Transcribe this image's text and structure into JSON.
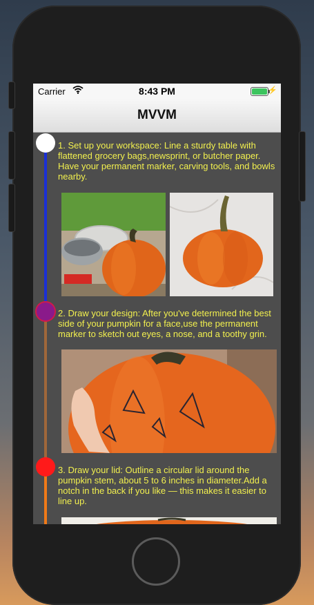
{
  "status_bar": {
    "carrier": "Carrier",
    "time": "8:43 PM",
    "battery_level": 1.0,
    "icons": [
      "wifi-icon",
      "battery-icon",
      "charging-bolt-icon"
    ]
  },
  "nav": {
    "title": "MVVM"
  },
  "colors": {
    "step_text": "#f2f04e",
    "background": "#4d4d4d",
    "line_step1": "#1a2fd6",
    "line_step2": "#a0673a",
    "line_step3": "#f07a18",
    "node_step1": "#ffffff",
    "node_step2": "#8a1a8a",
    "node_step3": "#ff1a1a"
  },
  "steps": [
    {
      "text": "1. Set up your workspace: Line a sturdy table with flattened grocery bags,newsprint, or butcher paper. Have your permanent marker, carving tools, and bowls nearby."
    },
    {
      "text": "2. Draw your design: After you've determined the best side of your pumpkin for a face,use the permanent marker to sketch out eyes, a nose, and a toothy grin."
    },
    {
      "text": "3. Draw your lid: Outline a circular lid around the pumpkin stem, about 5 to 6 inches in diameter.Add a notch in the back if you like — this makes it easier to line up."
    }
  ]
}
